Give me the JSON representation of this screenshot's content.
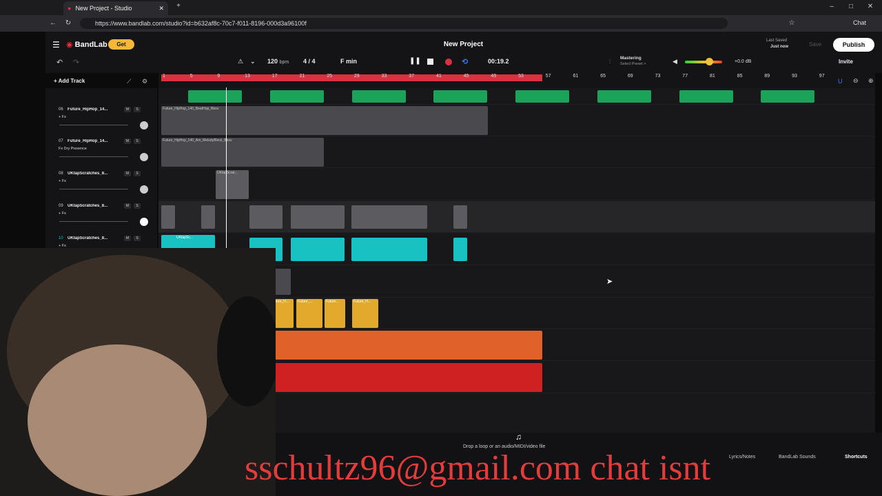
{
  "browser": {
    "tab_title": "New Project - Studio",
    "url": "https://www.bandlab.com/studio?id=b632af8c-70c7-f011-8196-000d3a96100f",
    "chat_label": "Chat"
  },
  "app": {
    "brand": "BandLab",
    "get_label": "Get",
    "project_title": "New Project",
    "add_track_label": "Add Track",
    "tempo": "120",
    "tempo_unit": "bpm",
    "time_signature": "4 / 4",
    "key": "F min",
    "time": "00:19.2",
    "mastering_label": "Mastering",
    "mastering_preset": "Select Preset >",
    "volume_db": "+0.0 dB",
    "last_saved_label": "Last Saved",
    "last_saved_value": "Just now",
    "save_label": "Save",
    "publish_label": "Publish",
    "invite_label": "Invite",
    "drop_hint": "Drop a loop or an audio/MIDI/video file",
    "lyrics_label": "Lyrics/Notes",
    "sounds_label": "BandLab Sounds",
    "shortcuts_label": "Shortcuts"
  },
  "ruler_ticks": [
    "1",
    "5",
    "9",
    "13",
    "17",
    "21",
    "25",
    "29",
    "33",
    "37",
    "41",
    "45",
    "49",
    "53",
    "57",
    "61",
    "65",
    "69",
    "73",
    "77",
    "81",
    "85",
    "89",
    "93",
    "97"
  ],
  "tracks": [
    {
      "num": "06",
      "name": "Future_HipHop_14...",
      "fx": "+ Fx",
      "clip_label": "Future_HipHop_140_BeatHop_Bbov"
    },
    {
      "num": "07",
      "name": "Future_HipHop_14...",
      "fx": "Fx Dry Presence",
      "clip_label": "Future_HipHop_140_Am_MelodyBlock_Bbov"
    },
    {
      "num": "08",
      "name": "UKtapScratches_8...",
      "fx": "+ Fx",
      "clip_label": "UKtapScrat..."
    },
    {
      "num": "09",
      "name": "UKtapScratches_8...",
      "fx": "+ Fx",
      "clip_label": ""
    },
    {
      "num": "10",
      "name": "UKtapScratches_8...",
      "fx": "+ Fx",
      "clip_label": "UKtapSc..."
    }
  ],
  "yellow_clip_labels": [
    "Future_H...",
    "Future_...",
    "Future...",
    "Future_H..."
  ],
  "overlay_text": "sschultz96@gmail.com    chat isnt",
  "colors": {
    "accent_red": "#d8323f",
    "green_clip": "#1aa45a",
    "teal_clip": "#19c2c2",
    "yellow_clip": "#e3a92d",
    "orange_clip": "#e0622a",
    "red_clip": "#cf2121",
    "gray_clip": "#5b5b60"
  }
}
